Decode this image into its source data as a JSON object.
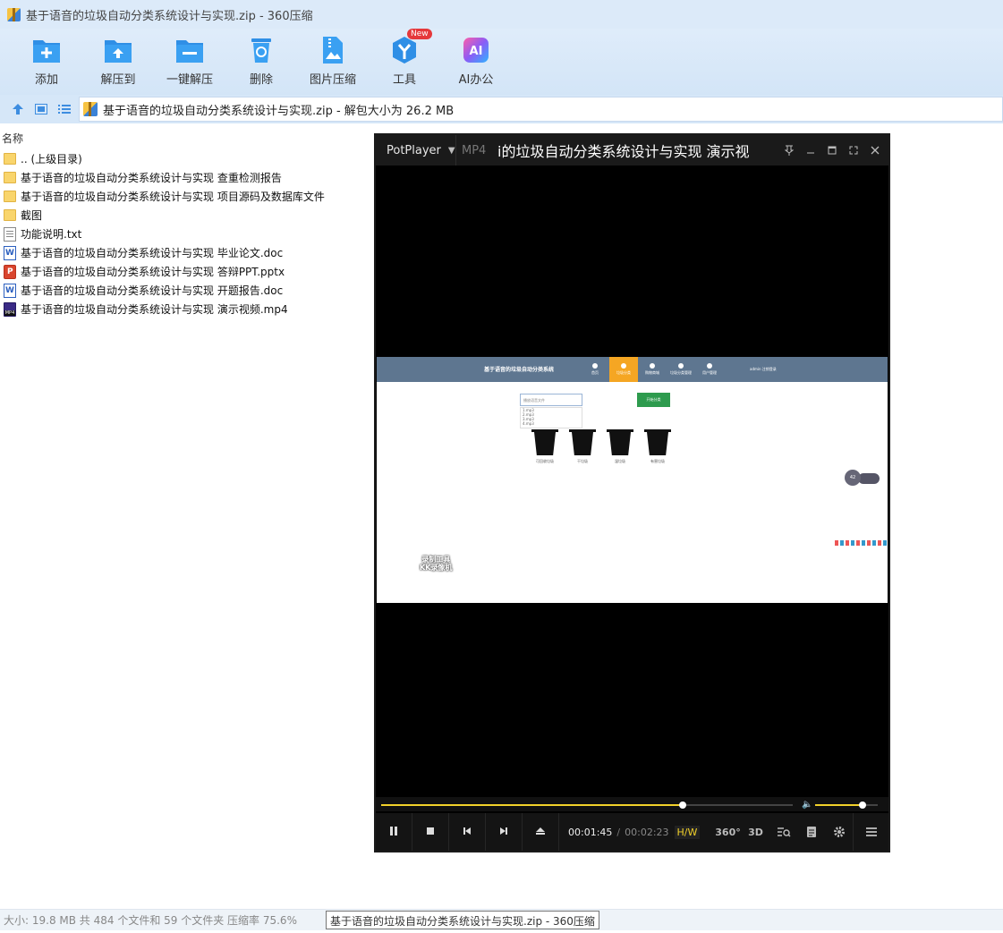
{
  "window": {
    "title": "基于语音的垃圾自动分类系统设计与实现.zip - 360压缩"
  },
  "toolbar": {
    "buttons": [
      {
        "label": "添加",
        "icon": "add-folder-icon"
      },
      {
        "label": "解压到",
        "icon": "extract-to-icon"
      },
      {
        "label": "一键解压",
        "icon": "quick-extract-icon"
      },
      {
        "label": "删除",
        "icon": "delete-icon"
      },
      {
        "label": "图片压缩",
        "icon": "image-compress-icon"
      },
      {
        "label": "工具",
        "icon": "tools-icon",
        "badge": "New"
      },
      {
        "label": "AI办公",
        "icon": "ai-office-icon"
      }
    ]
  },
  "address": {
    "path": "基于语音的垃圾自动分类系统设计与实现.zip - 解包大小为 26.2 MB"
  },
  "filelist": {
    "column_name": "名称",
    "items": [
      {
        "name": ".. (上级目录)",
        "type": "folder"
      },
      {
        "name": "基于语音的垃圾自动分类系统设计与实现 查重检测报告",
        "type": "folder"
      },
      {
        "name": "基于语音的垃圾自动分类系统设计与实现 项目源码及数据库文件",
        "type": "folder"
      },
      {
        "name": "截图",
        "type": "folder"
      },
      {
        "name": "功能说明.txt",
        "type": "txt"
      },
      {
        "name": "基于语音的垃圾自动分类系统设计与实现 毕业论文.doc",
        "type": "doc"
      },
      {
        "name": "基于语音的垃圾自动分类系统设计与实现 答辩PPT.pptx",
        "type": "ppt"
      },
      {
        "name": "基于语音的垃圾自动分类系统设计与实现 开题报告.doc",
        "type": "doc"
      },
      {
        "name": "基于语音的垃圾自动分类系统设计与实现 演示视频.mp4",
        "type": "mp4"
      }
    ]
  },
  "status": {
    "summary": "大小: 19.8 MB 共 484 个文件和 59 个文件夹 压缩率 75.6%",
    "tooltip": "基于语音的垃圾自动分类系统设计与实现.zip - 360压缩"
  },
  "player": {
    "brand": "PotPlayer",
    "format": "MP4",
    "movie_title": "i的垃圾自动分类系统设计与实现 演示视",
    "current_time": "00:01:45",
    "total_time": "00:02:23",
    "hw_label": "H/W",
    "seek_progress": 0.733,
    "volume": 0.75,
    "right_buttons": [
      "360°",
      "3D"
    ],
    "video": {
      "site_title": "基于语音的垃圾自动分类系统",
      "menu": [
        "首页",
        "垃圾分类",
        "购物商城",
        "垃圾分类管理",
        "用户管理"
      ],
      "user": "admin 注销登录",
      "select_placeholder": "播放语音文件",
      "options": [
        "1.mp3",
        "2.mp3",
        "3.mp3",
        "4.mp3"
      ],
      "action_button": "开始分类",
      "bins": [
        "可回收垃圾",
        "干垃圾",
        "湿垃圾",
        "有害垃圾"
      ],
      "badge": "42",
      "watermark_line1": "录制工具",
      "watermark_line2": "KK录像机"
    }
  }
}
